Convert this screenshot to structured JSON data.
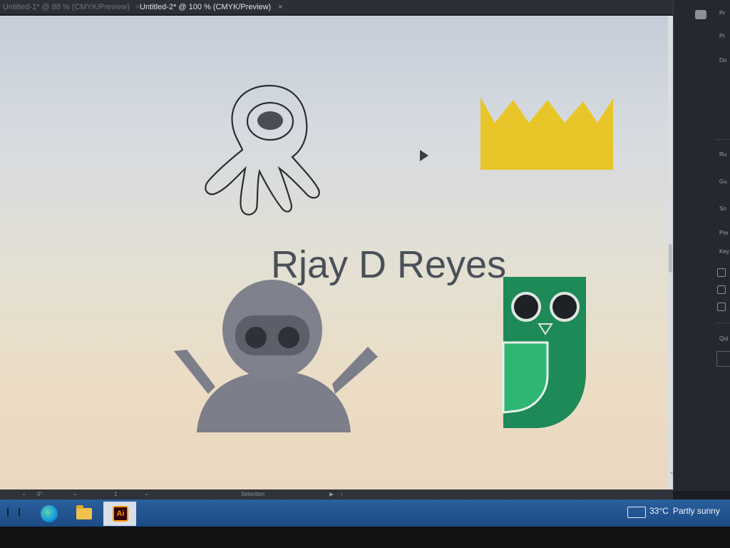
{
  "tabs": {
    "inactive_label": "Untitled-1* @ 88 % (CMYK/Preview)",
    "active_label": "Untitled-2* @ 100 % (CMYK/Preview)",
    "close_glyph": "×"
  },
  "artboard": {
    "name_text": "Rjay D Reyes",
    "shapes": [
      "alien-squid",
      "crown",
      "ninja-robot",
      "owl"
    ]
  },
  "right_panel": {
    "labels": [
      "Pr",
      "Pr",
      "Do",
      "Ru",
      "Gu",
      "Sn",
      "Pre",
      "Key",
      "Qui"
    ],
    "checkbox_count": 3
  },
  "status_bar": {
    "zoom_value": "",
    "rotation": "0°",
    "artboard_number": "1",
    "tool_label": "Selection"
  },
  "taskbar": {
    "apps": [
      "task-view",
      "edge",
      "file-explorer",
      "adobe-illustrator"
    ],
    "ai_label": "Ai",
    "temperature": "33°C",
    "condition": "Partly sunny"
  },
  "colors": {
    "crown": "#e8c62a",
    "owl_dark": "#1e8a57",
    "owl_light": "#2fb673",
    "ninja": "#7c7e8a",
    "taskbar": "#1d4b84"
  }
}
